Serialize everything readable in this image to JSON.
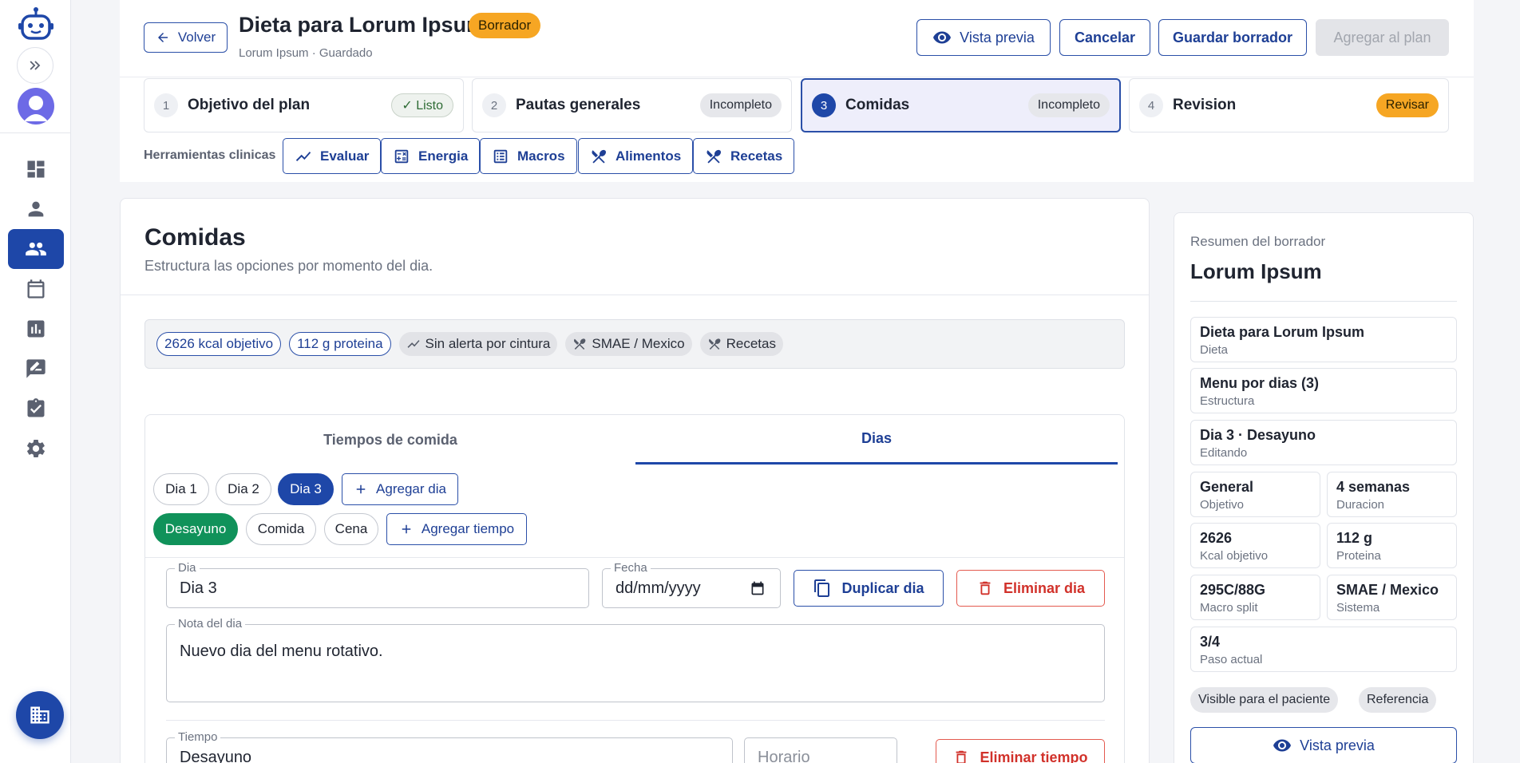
{
  "header": {
    "back_label": "Volver",
    "title": "Dieta para Lorum Ipsum",
    "status_badge": "Borrador",
    "subtitle": "Lorum Ipsum · Guardado",
    "preview_label": "Vista previa",
    "cancel_label": "Cancelar",
    "save_draft_label": "Guardar borrador",
    "add_to_plan_label": "Agregar al plan"
  },
  "steps": [
    {
      "num": "1",
      "label": "Objetivo del plan",
      "tag": "✓ Listo"
    },
    {
      "num": "2",
      "label": "Pautas generales",
      "tag": "Incompleto"
    },
    {
      "num": "3",
      "label": "Comidas",
      "tag": "Incompleto"
    },
    {
      "num": "4",
      "label": "Revision",
      "tag": "Revisar"
    }
  ],
  "tools": {
    "label": "Herramientas clinicas",
    "items": [
      "Evaluar",
      "Energia",
      "Macros",
      "Alimentos",
      "Recetas"
    ]
  },
  "main": {
    "title": "Comidas",
    "description": "Estructura las opciones por momento del dia.",
    "chips": [
      "2626 kcal objetivo",
      "112 g proteina",
      "Sin alerta por cintura",
      "SMAE / Mexico",
      "Recetas"
    ],
    "tabs": [
      "Tiempos de comida",
      "Dias"
    ],
    "days": [
      "Dia 1",
      "Dia 2",
      "Dia 3"
    ],
    "add_day_label": "Agregar dia",
    "meal_times": [
      "Desayuno",
      "Comida",
      "Cena"
    ],
    "add_time_label": "Agregar tiempo",
    "day_field": {
      "label": "Dia",
      "value": "Dia 3"
    },
    "date_field": {
      "label": "Fecha",
      "placeholder": "dd/mm/yyyy"
    },
    "duplicate_day_label": "Duplicar dia",
    "delete_day_label": "Eliminar dia",
    "note_field": {
      "label": "Nota del dia",
      "value": "Nuevo dia del menu rotativo."
    },
    "time_field": {
      "label": "Tiempo",
      "value": "Desayuno"
    },
    "schedule_placeholder": "Horario",
    "delete_time_label": "Eliminar tiempo"
  },
  "summary": {
    "label": "Resumen del borrador",
    "name": "Lorum Ipsum",
    "rows": [
      {
        "value": "Dieta para Lorum Ipsum",
        "key": "Dieta"
      },
      {
        "value": "Menu por dias (3)",
        "key": "Estructura"
      },
      {
        "value": "Dia 3 · Desayuno",
        "key": "Editando"
      }
    ],
    "grid": [
      {
        "value": "General",
        "key": "Objetivo"
      },
      {
        "value": "4 semanas",
        "key": "Duracion"
      },
      {
        "value": "2626",
        "key": "Kcal objetivo"
      },
      {
        "value": "112 g",
        "key": "Proteina"
      },
      {
        "value": "295C/88G",
        "key": "Macro split"
      },
      {
        "value": "SMAE / Mexico",
        "key": "Sistema"
      }
    ],
    "step_row": {
      "value": "3/4",
      "key": "Paso actual"
    },
    "chips": [
      "Visible para el paciente",
      "Referencia"
    ],
    "preview_label": "Vista previa"
  },
  "colors": {
    "primary": "#1e47a8",
    "warning": "#f6a623",
    "success": "#10925a",
    "danger": "#d1312a"
  }
}
